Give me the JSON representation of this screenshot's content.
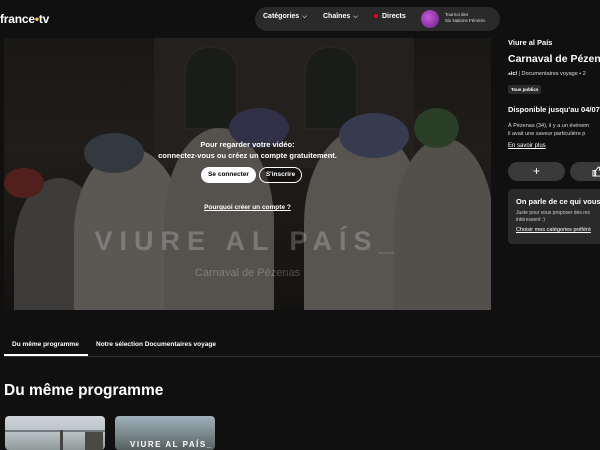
{
  "header": {
    "logo_text": "france",
    "logo_suffix": "tv",
    "nav": {
      "categories": "Catégories",
      "chaines": "Chaînes",
      "directs": "Directs",
      "tournoi_line1": "Tournoi des",
      "tournoi_line2": "Six Nations Féminin"
    }
  },
  "player": {
    "login_line1": "Pour regarder votre vidéo:",
    "login_line2": "connectez-vous ou créez un compte gratuitement.",
    "login_button": "Se connecter",
    "signup_button": "S'inscrire",
    "why_link": "Pourquoi créer un compte ?",
    "watermark_title": "VIURE AL PAÍS_",
    "watermark_subtitle": "Carnaval de Pézenas"
  },
  "details": {
    "program_name": "Viure al País",
    "episode_title": "Carnaval de Pézenas",
    "channel": "ici",
    "category": "Documentaires voyage",
    "meta_extra": "2",
    "badge": "Tous publics",
    "availability": "Disponible jusqu'au 04/07",
    "desc_line1": "À Pézenas (34), il y a un événem",
    "desc_line2": "il avait une saveur particulière p",
    "more_link": "En savoir plus",
    "add_icon": "+",
    "reco_title": "On parle de ce qui vous",
    "reco_desc_line1": "Juste pour vous proposer des rec",
    "reco_desc_line2": "intéressent :)",
    "reco_link": "Choisir mes catégories préféré"
  },
  "tabs": [
    {
      "label": "Du même programme",
      "active": true
    },
    {
      "label": "Notre sélection Documentaires voyage",
      "active": false
    }
  ],
  "section": {
    "title": "Du même programme",
    "thumbnail_2_text": "VIURE AL PAÍS_"
  },
  "colors": {
    "background": "#101010",
    "live_dot": "#e8002d",
    "logo_dot": "#ffd23f"
  }
}
